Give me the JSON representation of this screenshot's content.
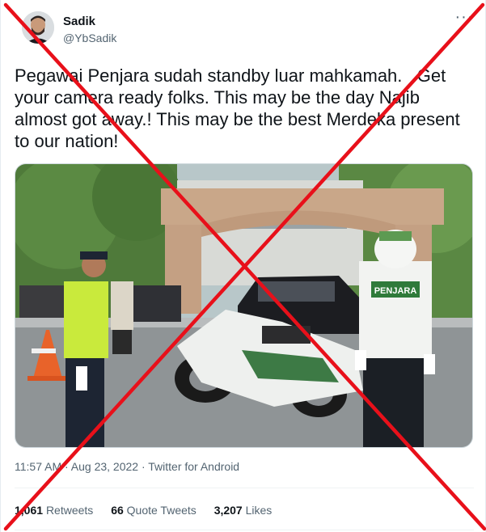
{
  "tweet": {
    "author_name": "Sadik",
    "author_handle": "@YbSadik",
    "text": "Pegawai Penjara sudah standby luar mahkamah.   Get your camera ready folks. This may be the day Najib almost got away.! This may be the best Merdeka present to our nation!",
    "timestamp": "11:57 AM · Aug 23, 2022 · Twitter for Android",
    "media": {
      "vest_text": "PENJARA"
    }
  },
  "stats": {
    "retweets_count": "1,061",
    "retweets_label": "Retweets",
    "quotes_count": "66",
    "quotes_label": "Quote Tweets",
    "likes_count": "3,207",
    "likes_label": "Likes"
  },
  "icons": {
    "more": "more-horizontal-icon",
    "overlay": "red-x-mark"
  },
  "colors": {
    "cross": "#e8101a",
    "secondary_text": "#536471"
  }
}
